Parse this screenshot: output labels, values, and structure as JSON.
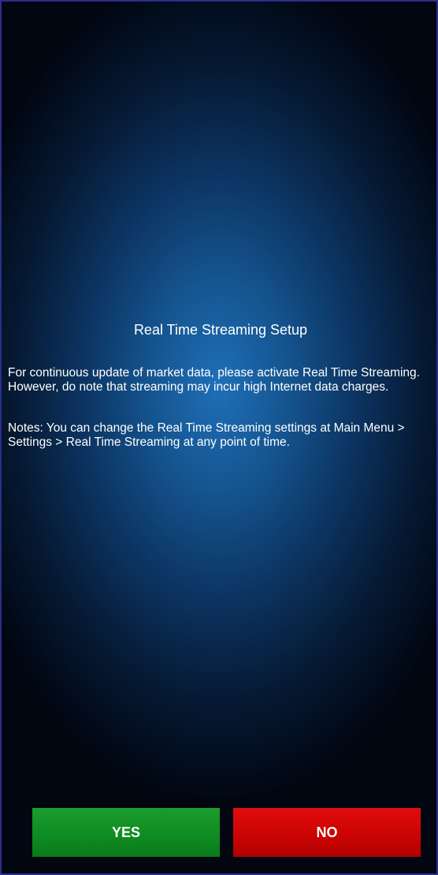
{
  "dialog": {
    "title": "Real Time Streaming Setup",
    "message": "For continuous update of market data, please activate Real Time Streaming. However, do note that streaming may incur high Internet data charges.",
    "notes": "Notes: You can change the Real Time Streaming settings at Main Menu > Settings > Real Time Streaming at any point of time."
  },
  "buttons": {
    "yes_label": "YES",
    "no_label": "NO"
  },
  "colors": {
    "yes_button": "#0f8c22",
    "no_button": "#cc0404",
    "background_center": "#1f6fb8",
    "background_edge": "#010611"
  }
}
